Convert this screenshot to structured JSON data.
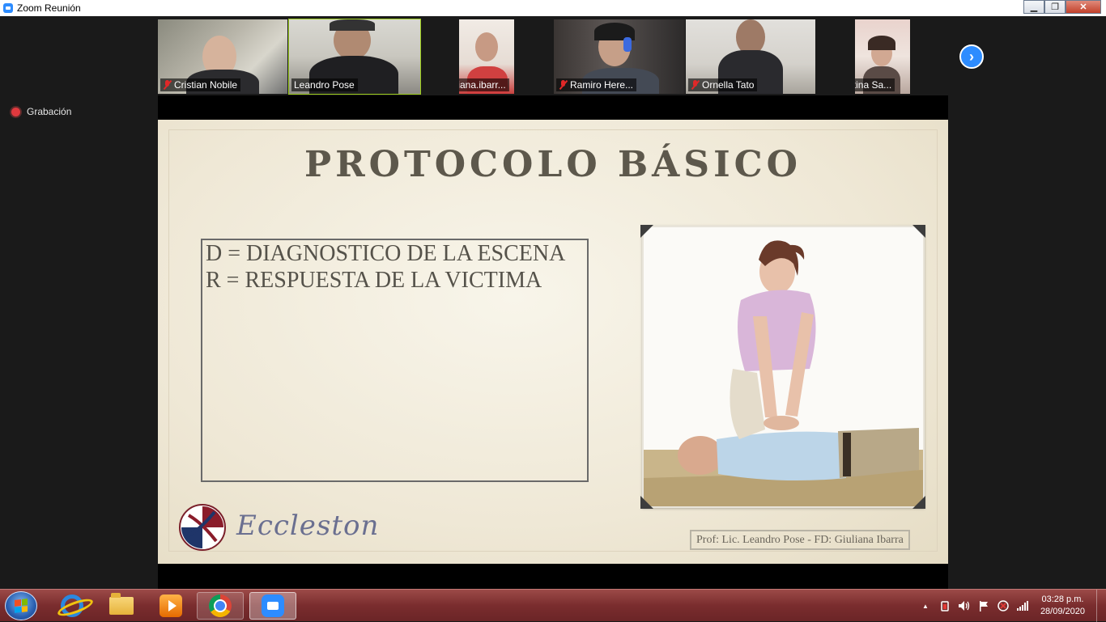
{
  "window": {
    "title": "Zoom Reunión",
    "minimize": "▁",
    "maximize": "❐",
    "close": "✕"
  },
  "recording": {
    "label": "Grabación"
  },
  "participants": [
    {
      "name": "Cristian Nobile",
      "muted": true
    },
    {
      "name": "Leandro Pose",
      "muted": false,
      "active_speaker": true
    },
    {
      "name": "Giuliana.ibarr...",
      "muted": true
    },
    {
      "name": "Ramiro Here...",
      "muted": true
    },
    {
      "name": "Ornella Tato",
      "muted": true
    },
    {
      "name": "Valentina Sa...",
      "muted": true
    }
  ],
  "gallery_next": {
    "icon": "chevron-right-icon",
    "glyph": "›"
  },
  "slide": {
    "title": "PROTOCOLO BÁSICO",
    "lines": [
      "D = DIAGNOSTICO DE LA ESCENA",
      "R = RESPUESTA DE LA VICTIMA"
    ],
    "brand": "Eccleston",
    "credit": "Prof: Lic. Leandro Pose - FD: Giuliana Ibarra"
  },
  "taskbar": {
    "apps": [
      "internet-explorer-icon",
      "file-explorer-icon",
      "media-player-icon",
      "chrome-icon",
      "zoom-icon"
    ],
    "tray_expand": "▲",
    "clock_time": "03:28 p.m.",
    "clock_date": "28/09/2020"
  },
  "colors": {
    "zoom_blue": "#2d8cff",
    "muted_red": "#e02828",
    "active_border": "#9ccc1c",
    "taskbar": "#7a2d2e"
  }
}
